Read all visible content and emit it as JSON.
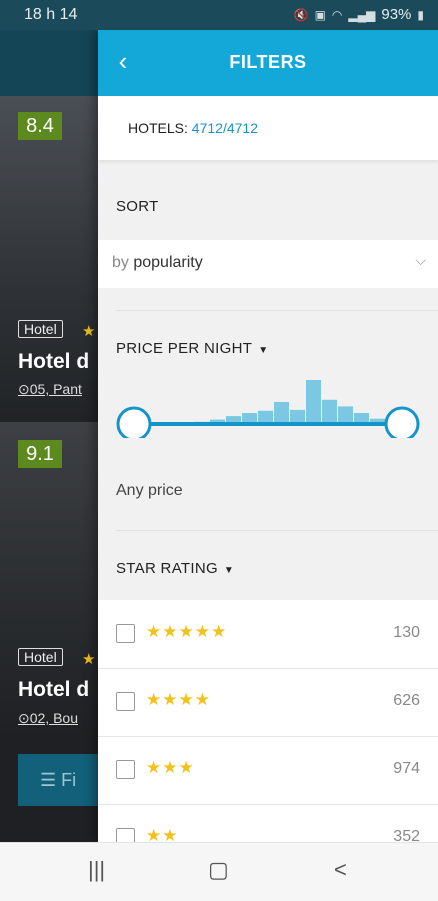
{
  "status_bar": {
    "time": "18 h 14",
    "battery": "93%",
    "icons": [
      "mute-icon",
      "lock-icon",
      "wifi-icon",
      "signal-icon",
      "battery-icon"
    ]
  },
  "background": {
    "cards": [
      {
        "score": "8.4",
        "type": "Hotel",
        "name": "Hotel d",
        "address": "05, Pant"
      },
      {
        "score": "9.1",
        "type": "Hotel",
        "name": "Hotel d",
        "address": "02, Bou"
      }
    ],
    "filter_button": "Fi"
  },
  "header": {
    "title": "FILTERS",
    "back_icon": "chevron-left-icon"
  },
  "hotels": {
    "label": "HOTELS:",
    "value": "4712/4712"
  },
  "sort": {
    "heading": "SORT",
    "prefix": "by",
    "value": "popularity"
  },
  "price": {
    "heading": "PRICE PER NIGHT",
    "value_text": "Any price",
    "histogram": [
      0.0,
      0.0,
      0.0,
      0.05,
      0.1,
      0.18,
      0.25,
      0.3,
      0.5,
      0.32,
      1.0,
      0.55,
      0.4,
      0.25,
      0.12,
      0.05
    ]
  },
  "star_rating": {
    "heading": "STAR RATING",
    "items": [
      {
        "stars": "★★★★★",
        "count": "130"
      },
      {
        "stars": "★★★★",
        "count": "626"
      },
      {
        "stars": "★★★",
        "count": "974"
      },
      {
        "stars": "★★",
        "count": "352"
      }
    ]
  },
  "colors": {
    "accent": "#14a8d8",
    "link": "#1594c8",
    "star": "#f2c21a",
    "histogram": "#7cc8e2"
  }
}
